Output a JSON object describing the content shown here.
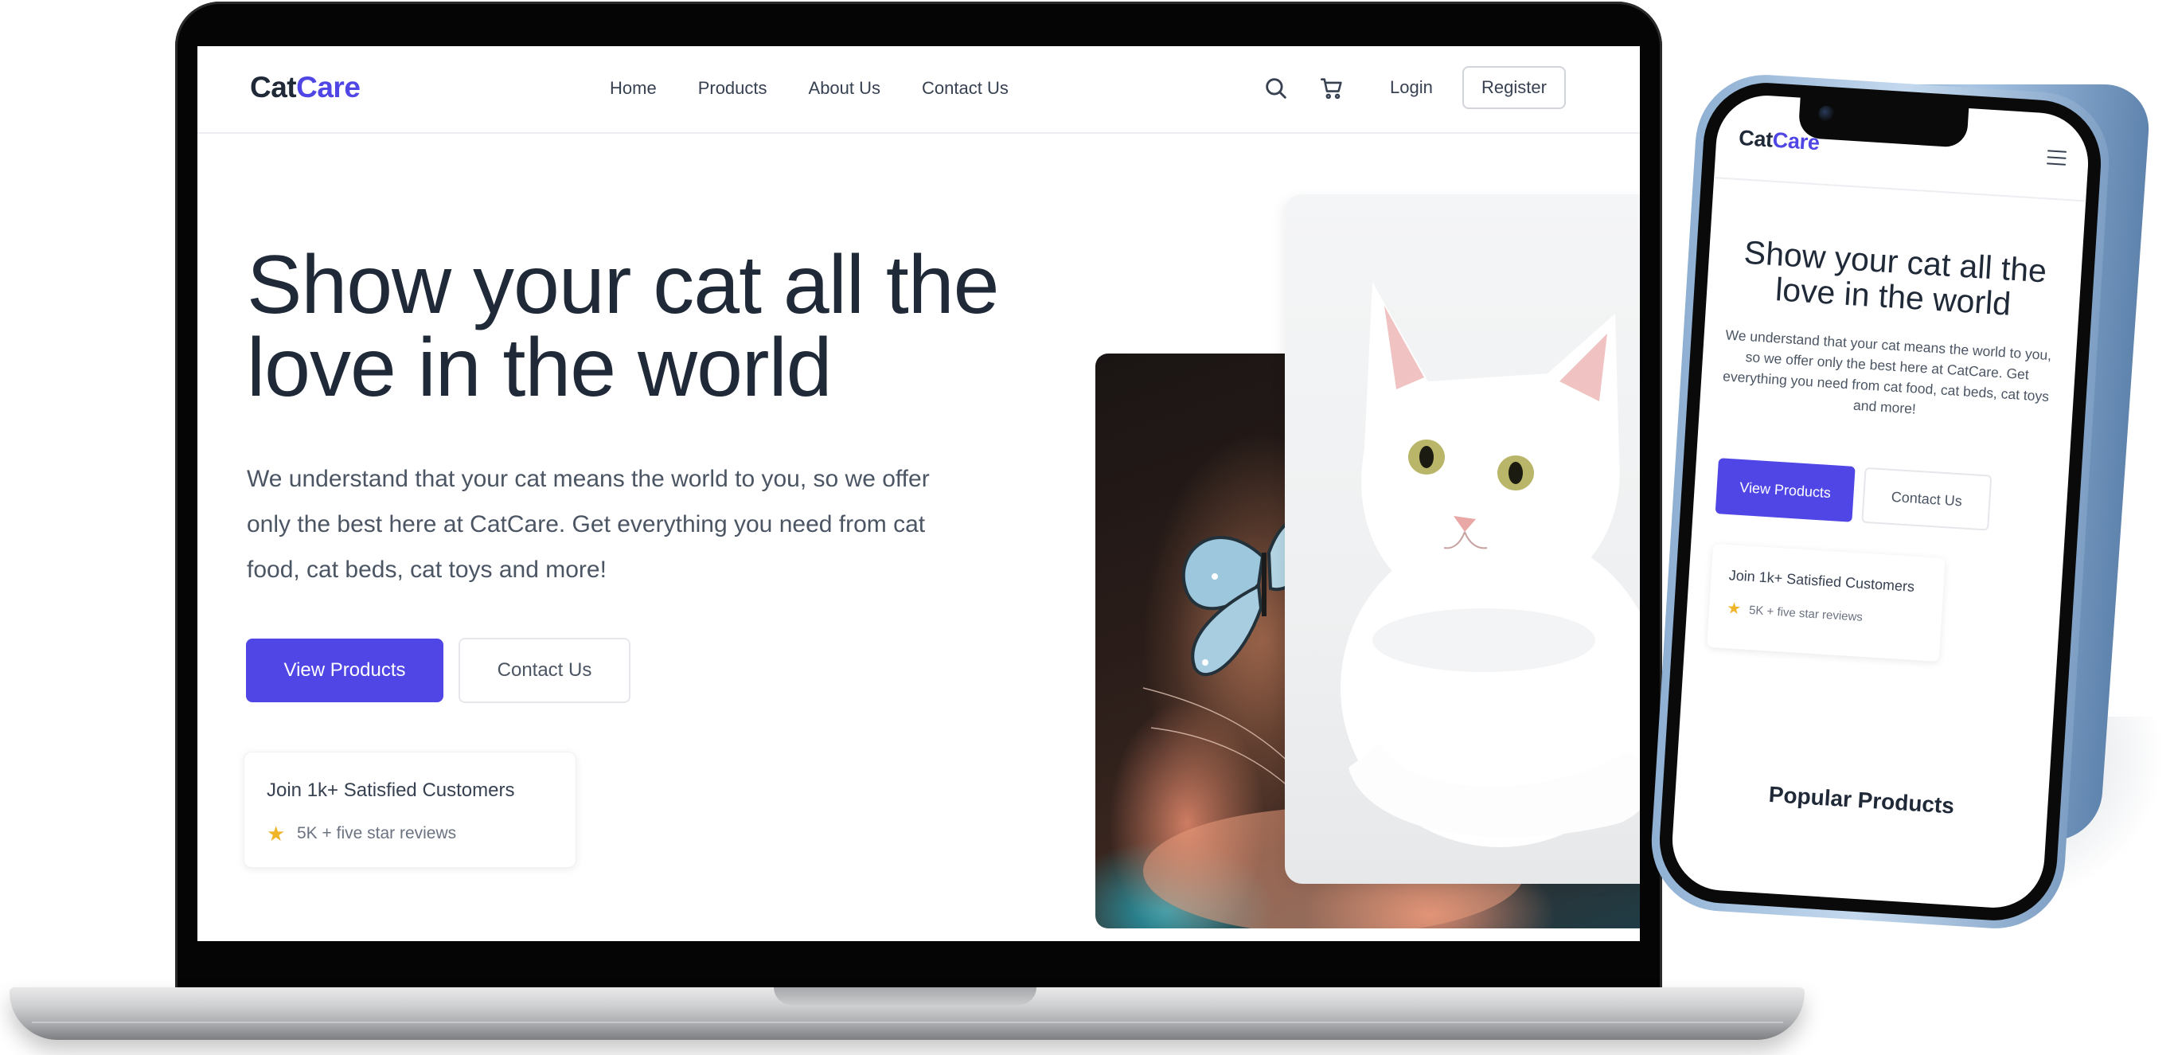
{
  "brand": {
    "name_part1": "Cat",
    "name_part2": "Care",
    "accent_color": "#4f46e5",
    "text_color": "#1f2937"
  },
  "nav": {
    "links": [
      "Home",
      "Products",
      "About Us",
      "Contact Us"
    ],
    "search_icon": "search-icon",
    "cart_icon": "cart-icon",
    "login_label": "Login",
    "register_label": "Register"
  },
  "hero": {
    "headline": "Show your cat all the love in the world",
    "paragraph": "We understand that your cat means the world to you, so we offer only the best here at CatCare. Get everything you need from cat food, cat beds, cat toys and more!",
    "primary_button": "View Products",
    "secondary_button": "Contact Us",
    "card_title": "Join 1k+ Satisfied Customers",
    "card_star_icon": "star-icon",
    "card_star_color": "#f0b429",
    "card_subtitle": "5K + five star reviews"
  },
  "mobile": {
    "menu_icon": "hamburger-menu-icon",
    "section_title": "Popular Products"
  }
}
